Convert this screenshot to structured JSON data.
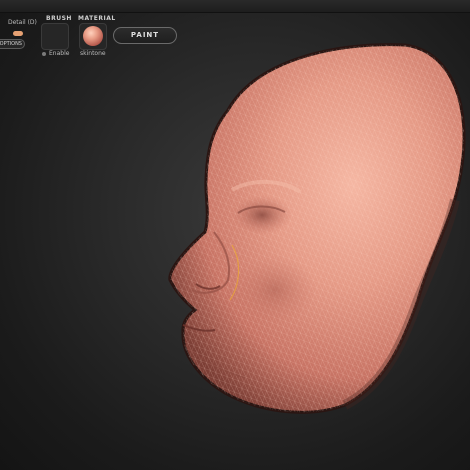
{
  "toolbar": {
    "detail_label": "Detail (D)",
    "brush_label": "BRUSH",
    "enable_label": "Enable",
    "material_label": "MATERIAL",
    "material_name": "skintone",
    "options_label": "OPTIONS",
    "paint_label": "PAINT"
  },
  "viewport": {
    "model": "head-mesh",
    "mesh_color": "#e6a08e"
  },
  "colors": {
    "background": "#2a2a2a",
    "accent": "#e6a173"
  }
}
